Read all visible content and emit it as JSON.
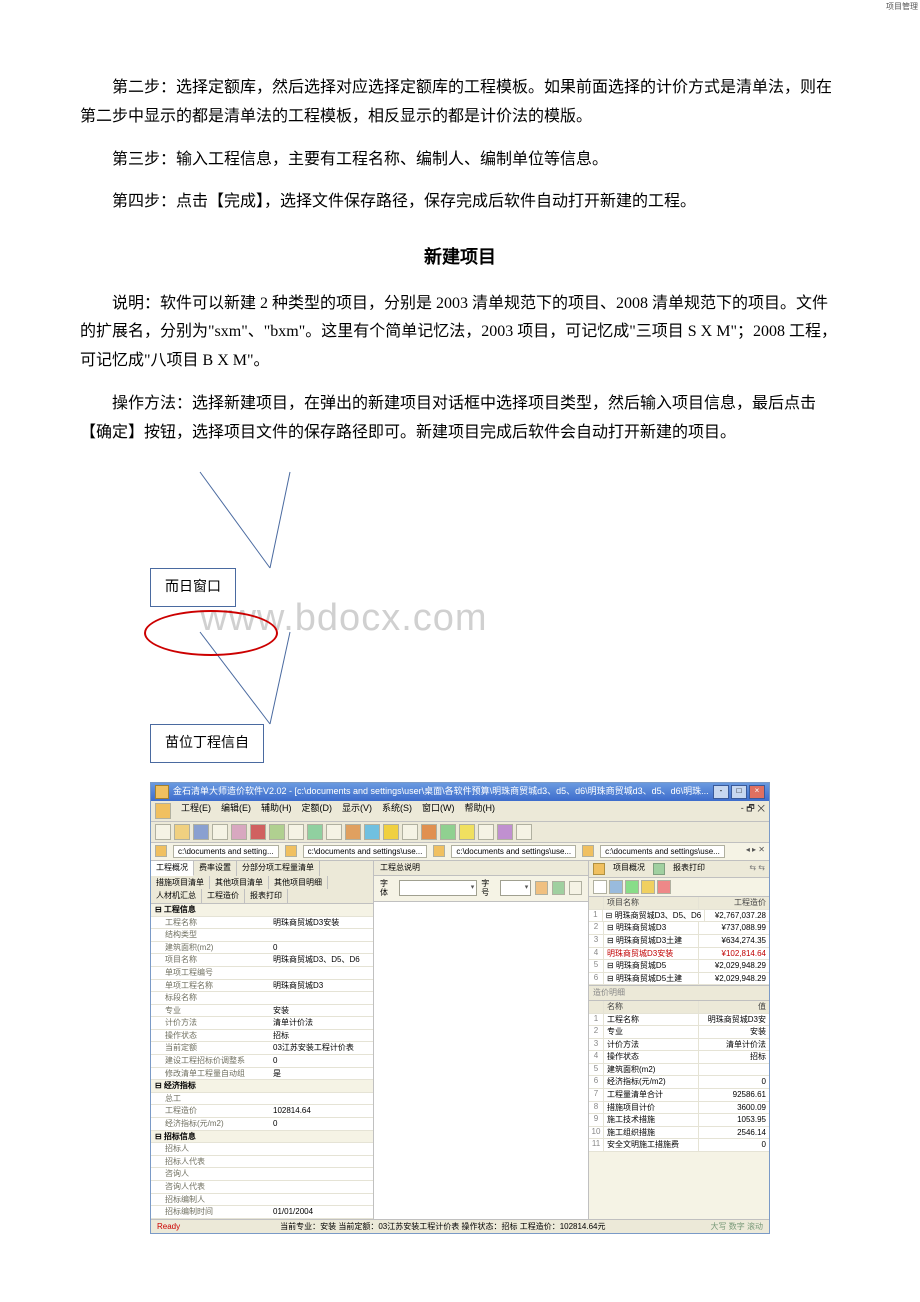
{
  "paragraphs": {
    "p1": "第二步：选择定额库，然后选择对应选择定额库的工程模板。如果前面选择的计价方式是清单法，则在第二步中显示的都是清单法的工程模板，相反显示的都是计价法的模版。",
    "p2": "第三步：输入工程信息，主要有工程名称、编制人、编制单位等信息。",
    "p3": "第四步：点击【完成】，选择文件保存路径，保存完成后软件自动打开新建的工程。",
    "heading": "新建项目",
    "p4": "说明：软件可以新建 2 种类型的项目，分别是 2003 清单规范下的项目、2008 清单规范下的项目。文件的扩展名，分别为\"sxm\"、\"bxm\"。这里有个简单记忆法，2003 项目，可记忆成\"三项目 S X M\"；2008 工程，可记忆成\"八项目 B X M\"。",
    "p5": "操作方法：选择新建项目，在弹出的新建项目对话框中选择项目类型，然后输入项目信息，最后点击【确定】按钮，选择项目文件的保存路径即可。新建项目完成后软件会自动打开新建的项目。"
  },
  "diagram": {
    "box1": "而日窗口",
    "box2": "苗位丁程信自",
    "watermark": "www.bdocx.com"
  },
  "app": {
    "title": "金石清单大师造价软件V2.02 - [c:\\documents and settings\\user\\桌面\\各软件预算\\明珠商贸城d3、d5、d6\\明珠商贸城d3、d5、d6\\明珠...",
    "menu": [
      "工程(E)",
      "编辑(E)",
      "辅助(H)",
      "定额(D)",
      "显示(V)",
      "系统(S)",
      "窗口(W)",
      "帮助(H)"
    ],
    "doc_tabs": [
      "c:\\documents and setting...",
      "c:\\documents and settings\\use...",
      "c:\\documents and settings\\use...",
      "c:\\documents and settings\\use..."
    ],
    "nav_tabs": [
      "工程概况",
      "费率设置",
      "分部分项工程量清单",
      "措施项目清单",
      "其他项目清单",
      "其他项目明细",
      "人材机汇总",
      "工程造价",
      "报表打印"
    ],
    "prop_groups": [
      {
        "group": "工程信息",
        "rows": [
          {
            "k": "工程名称",
            "v": "明珠商贸城D3安装"
          },
          {
            "k": "结构类型",
            "v": ""
          },
          {
            "k": "建筑面积(m2)",
            "v": "0"
          },
          {
            "k": "项目名称",
            "v": "明珠商贸城D3、D5、D6"
          },
          {
            "k": "单项工程编号",
            "v": ""
          },
          {
            "k": "单项工程名称",
            "v": "明珠商贸城D3"
          },
          {
            "k": "标段名称",
            "v": ""
          },
          {
            "k": "专业",
            "v": "安装"
          },
          {
            "k": "计价方法",
            "v": "清单计价法"
          },
          {
            "k": "操作状态",
            "v": "招标"
          },
          {
            "k": "当前定额",
            "v": "03江苏安装工程计价表"
          },
          {
            "k": "建设工程招标价调整系",
            "v": "0"
          },
          {
            "k": "修改清单工程量自动组",
            "v": "是"
          }
        ]
      },
      {
        "group": "经济指标",
        "rows": [
          {
            "k": "总工",
            "v": ""
          },
          {
            "k": "工程造价",
            "v": "102814.64"
          },
          {
            "k": "经济指标(元/m2)",
            "v": "0"
          }
        ]
      },
      {
        "group": "招标信息",
        "rows": [
          {
            "k": "招标人",
            "v": ""
          },
          {
            "k": "招标人代表",
            "v": ""
          },
          {
            "k": "咨询人",
            "v": ""
          },
          {
            "k": "咨询人代表",
            "v": ""
          },
          {
            "k": "招标编制人",
            "v": ""
          },
          {
            "k": "招标编制时间",
            "v": "01/01/2004"
          }
        ]
      }
    ],
    "center": {
      "header": "工程总说明",
      "font_label": "字体",
      "size_label": "字号"
    },
    "right": {
      "title": "项目管理",
      "close": "▾ ✕",
      "tabs": [
        "项目概况",
        "报表打印"
      ],
      "cols": [
        "",
        "项目名称",
        "工程造价"
      ],
      "rows": [
        {
          "n": "1",
          "name": "明珠商贸城D3、D5、D6",
          "val": "¥2,767,037.28"
        },
        {
          "n": "2",
          "name": "明珠商贸城D3",
          "val": "¥737,088.99"
        },
        {
          "n": "3",
          "name": "明珠商贸城D3土建",
          "val": "¥634,274.35"
        },
        {
          "n": "4",
          "name": "明珠商贸城D3安装",
          "val": "¥102,814.64",
          "sel": true
        },
        {
          "n": "5",
          "name": "明珠商贸城D5",
          "val": "¥2,029,948.29"
        },
        {
          "n": "6",
          "name": "明珠商贸城D5土建",
          "val": "¥2,029,948.29"
        }
      ],
      "detail_title": "造价明细",
      "detail_cols": [
        "",
        "名称",
        "值"
      ],
      "details": [
        {
          "n": "1",
          "name": "工程名称",
          "val": "明珠商贸城D3安"
        },
        {
          "n": "2",
          "name": "专业",
          "val": "安装"
        },
        {
          "n": "3",
          "name": "计价方法",
          "val": "清单计价法"
        },
        {
          "n": "4",
          "name": "操作状态",
          "val": "招标"
        },
        {
          "n": "5",
          "name": "建筑面积(m2)",
          "val": ""
        },
        {
          "n": "6",
          "name": "经济指标(元/m2)",
          "val": "0"
        },
        {
          "n": "7",
          "name": "工程量清单合计",
          "val": "92586.61"
        },
        {
          "n": "8",
          "name": "措施项目计价",
          "val": "3600.09"
        },
        {
          "n": "9",
          "name": "施工技术措施",
          "val": "1053.95"
        },
        {
          "n": "10",
          "name": "施工组织措施",
          "val": "2546.14"
        },
        {
          "n": "11",
          "name": "安全文明施工措施费",
          "val": "0"
        }
      ]
    },
    "status": {
      "ready": "Ready",
      "text": "当前专业：安装  当前定额：03江苏安装工程计价表  操作状态：招标  工程造价：102814.64元",
      "tail": "大写 数字 滚动"
    }
  }
}
